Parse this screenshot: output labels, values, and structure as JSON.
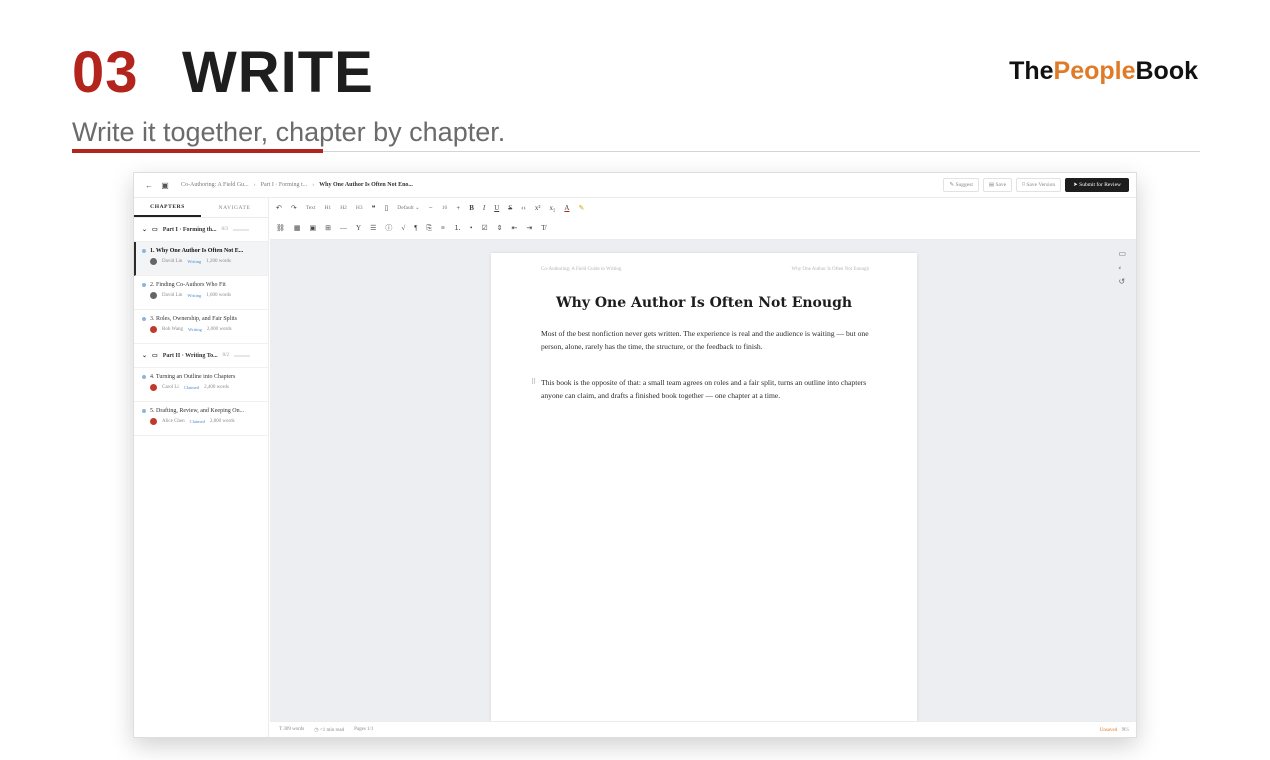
{
  "slide": {
    "number": "03",
    "title": "WRITE",
    "subtitle": "Write it together, chapter by chapter.",
    "brand_pre": "The",
    "brand_mid": "People",
    "brand_post": "Book"
  },
  "app": {
    "breadcrumbs": [
      "Co-Authoring: A Field Gu...",
      "Part I · Forming t...",
      "Why One Author Is Often Not Eno..."
    ],
    "actions": {
      "suggest": "Suggest",
      "save": "Save",
      "save_version": "Save Version",
      "submit": "Submit for Review"
    },
    "sidebar": {
      "tabs": [
        "CHAPTERS",
        "NAVIGATE"
      ],
      "parts": [
        {
          "title": "Part I · Forming th...",
          "count": "0/3",
          "chapters": [
            {
              "title": "1. Why One Author Is Often Not E...",
              "author": "David Lin",
              "status": "Writing",
              "words": "1,200 words"
            },
            {
              "title": "2. Finding Co-Authors Who Fit",
              "author": "David Lin",
              "status": "Writing",
              "words": "1,600 words"
            },
            {
              "title": "3. Roles, Ownership, and Fair Splits",
              "author": "Bob Wang",
              "status": "Writing",
              "words": "2,000 words"
            }
          ]
        },
        {
          "title": "Part II · Writing To...",
          "count": "0/2",
          "chapters": [
            {
              "title": "4. Turning an Outline into Chapters",
              "author": "Carol Li",
              "status": "Claimed",
              "words": "2,400 words"
            },
            {
              "title": "5. Drafting, Review, and Keeping On...",
              "author": "Alice Chen",
              "status": "Claimed",
              "words": "2,800 words"
            }
          ]
        }
      ]
    },
    "toolbar": {
      "text": "Text",
      "h1": "H1",
      "h2": "H2",
      "h3": "H3",
      "font": "Default",
      "size": "16"
    },
    "document": {
      "running_left": "Co-Authoring: A Field Guide to Writing",
      "running_right": "Why One Author Is Often Not Enough",
      "title": "Why One Author Is Often Not Enough",
      "paragraph1": "Most of the best nonfiction never gets written. The experience is real and the audience is waiting — but one person, alone, rarely has the time, the structure, or the feedback to finish.",
      "paragraph2": "This book is the opposite of that: a small team agrees on roles and a fair split, turns an outline into chapters anyone can claim, and drafts a finished book together — one chapter at a time."
    },
    "status": {
      "words": "309 words",
      "read_time": "<1 min read",
      "pages": "Pages 1/1",
      "save_state": "Unsaved",
      "save_icon": "⌘S"
    }
  },
  "colors": {
    "accent_red": "#b3241d",
    "accent_orange": "#e07a26",
    "primary_button": "#1d1d1d",
    "status_link": "#4a8bd6"
  }
}
